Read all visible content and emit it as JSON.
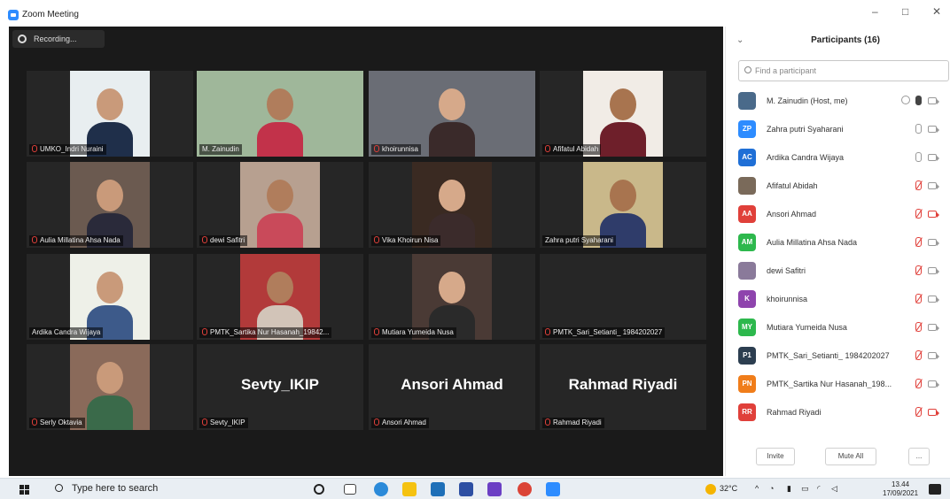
{
  "window": {
    "title": "Zoom Meeting",
    "minimize": "–",
    "restore": "□",
    "close": "✕"
  },
  "recording": {
    "label": "Recording..."
  },
  "tiles": [
    {
      "name": "UMKO_Indri Nuraini",
      "muted": true,
      "video": true
    },
    {
      "name": "M. Zainudin",
      "muted": false,
      "video": true,
      "active": true
    },
    {
      "name": "khoirunnisa",
      "muted": true,
      "video": true
    },
    {
      "name": "Afifatul Abidah",
      "muted": true,
      "video": true
    },
    {
      "name": "Aulia Millatina Ahsa Nada",
      "muted": true,
      "video": true
    },
    {
      "name": "dewi Safitri",
      "muted": true,
      "video": true
    },
    {
      "name": "Vika Khoirun Nisa",
      "muted": true,
      "video": true
    },
    {
      "name": "Zahra putri Syaharani",
      "muted": false,
      "video": true
    },
    {
      "name": "Ardika Candra Wijaya",
      "muted": false,
      "video": true
    },
    {
      "name": "PMTK_Sartika Nur Hasanah_19842...",
      "muted": true,
      "video": true
    },
    {
      "name": "Mutiara Yumeida Nusa",
      "muted": true,
      "video": true
    },
    {
      "name": "PMTK_Sari_Setianti_ 1984202027",
      "muted": true,
      "video": false
    },
    {
      "name": "Serly Oktavia",
      "muted": true,
      "video": true
    },
    {
      "name": "Sevty_IKIP",
      "muted": true,
      "video": false,
      "big": "Sevty_IKIP"
    },
    {
      "name": "Ansori Ahmad",
      "muted": true,
      "video": false,
      "big": "Ansori Ahmad"
    },
    {
      "name": "Rahmad Riyadi",
      "muted": true,
      "video": false,
      "big": "Rahmad Riyadi"
    }
  ],
  "participants": {
    "title": "Participants (16)",
    "search_placeholder": "Find a participant",
    "items": [
      {
        "name": "M. Zainudin (Host, me)",
        "initials": "",
        "color": "#4a6a8a",
        "mic": "active",
        "cam": "on"
      },
      {
        "name": "Zahra putri Syaharani",
        "initials": "ZP",
        "color": "#2d8cff",
        "mic": "on",
        "cam": "on"
      },
      {
        "name": "Ardika Candra Wijaya",
        "initials": "AC",
        "color": "#1f6fd6",
        "mic": "on",
        "cam": "on"
      },
      {
        "name": "Afifatul Abidah",
        "initials": "",
        "color": "#7a6a5a",
        "mic": "muted",
        "cam": "on"
      },
      {
        "name": "Ansori Ahmad",
        "initials": "AA",
        "color": "#e0403a",
        "mic": "muted",
        "cam": "off"
      },
      {
        "name": "Aulia Millatina Ahsa Nada",
        "initials": "AM",
        "color": "#2db84d",
        "mic": "muted",
        "cam": "on"
      },
      {
        "name": "dewi Safitri",
        "initials": "",
        "color": "#8a7a9a",
        "mic": "muted",
        "cam": "on"
      },
      {
        "name": "khoirunnisa",
        "initials": "K",
        "color": "#8e44ad",
        "mic": "muted",
        "cam": "on"
      },
      {
        "name": "Mutiara Yumeida Nusa",
        "initials": "MY",
        "color": "#2db84d",
        "mic": "muted",
        "cam": "on"
      },
      {
        "name": "PMTK_Sari_Setianti_ 1984202027",
        "initials": "P1",
        "color": "#2c3e50",
        "mic": "muted",
        "cam": "on"
      },
      {
        "name": "PMTK_Sartika Nur Hasanah_198...",
        "initials": "PN",
        "color": "#f07d1a",
        "mic": "muted",
        "cam": "on"
      },
      {
        "name": "Rahmad Riyadi",
        "initials": "RR",
        "color": "#e0403a",
        "mic": "muted",
        "cam": "off"
      }
    ],
    "invite_label": "Invite",
    "mute_all_label": "Mute All",
    "more_label": "..."
  },
  "taskbar": {
    "search_placeholder": "Type here to search",
    "weather": "32°C",
    "time": "13.44",
    "date": "17/09/2021"
  }
}
